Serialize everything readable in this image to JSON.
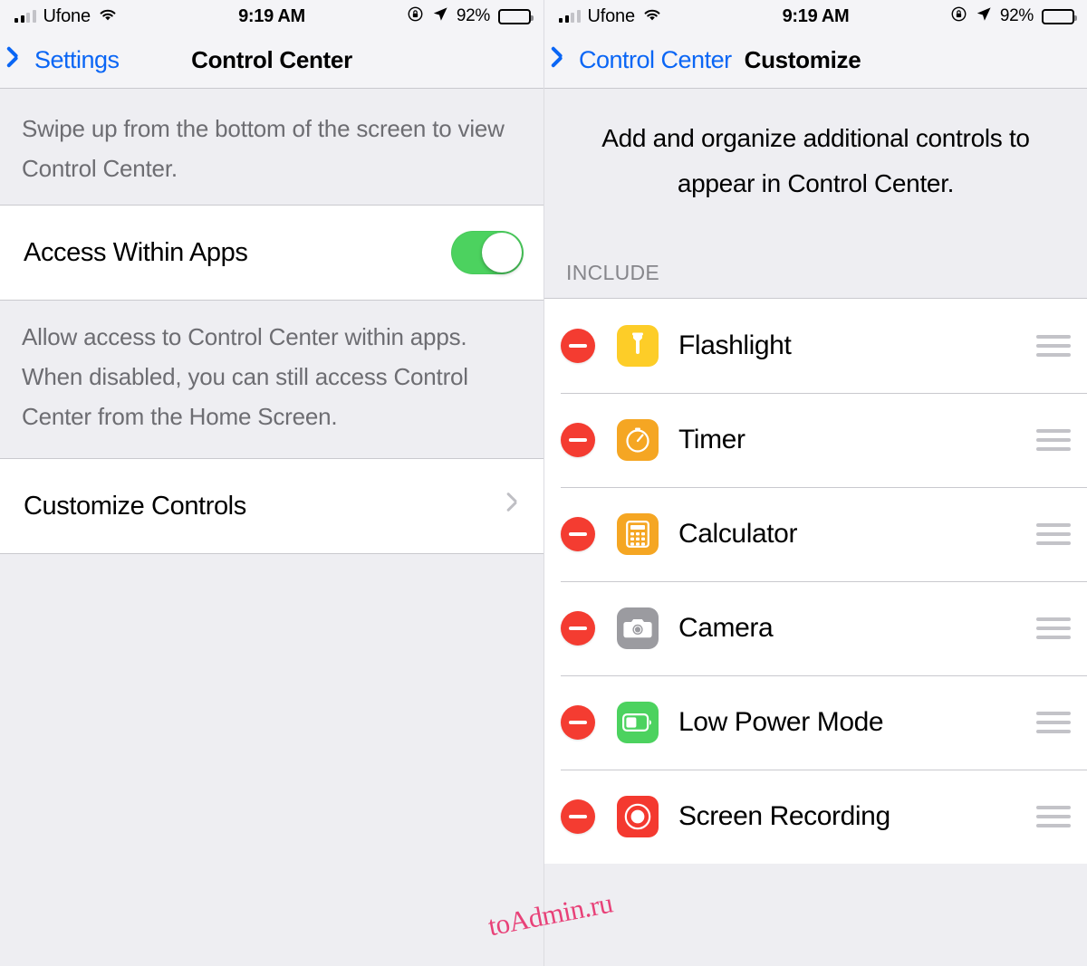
{
  "status_bar": {
    "carrier": "Ufone",
    "time": "9:19 AM",
    "battery_percent": "92%",
    "signal_bars_filled": 2,
    "signal_bars_total": 4,
    "icons": [
      "signal-bars-icon",
      "wifi-icon",
      "rotation-lock-icon",
      "location-arrow-icon",
      "battery-icon"
    ]
  },
  "left_screen": {
    "nav": {
      "back_label": "Settings",
      "title": "Control Center"
    },
    "header_footnote": "Swipe up from the bottom of the screen to view Control Center.",
    "access_row": {
      "label": "Access Within Apps",
      "toggle_state": "on",
      "toggle_color": "#4cd25f"
    },
    "access_footnote": "Allow access to Control Center within apps. When disabled, you can still access Control Center from the Home Screen.",
    "customize_row": {
      "label": "Customize Controls",
      "accessory": "chevron-right-icon"
    }
  },
  "right_screen": {
    "nav": {
      "back_label": "Control Center",
      "title": "Customize"
    },
    "intro": "Add and organize additional controls to appear in Control Center.",
    "section_header": "INCLUDE",
    "rows": [
      {
        "label": "Flashlight",
        "icon": "flashlight-icon",
        "icon_bg": "#fdcd28",
        "action": "remove",
        "handle": "reorder-handle-icon"
      },
      {
        "label": "Timer",
        "icon": "timer-icon",
        "icon_bg": "#f5a623",
        "action": "remove",
        "handle": "reorder-handle-icon"
      },
      {
        "label": "Calculator",
        "icon": "calculator-icon",
        "icon_bg": "#f5a623",
        "action": "remove",
        "handle": "reorder-handle-icon"
      },
      {
        "label": "Camera",
        "icon": "camera-icon",
        "icon_bg": "#9b9ba0",
        "action": "remove",
        "handle": "reorder-handle-icon"
      },
      {
        "label": "Low Power Mode",
        "icon": "battery-low-power-icon",
        "icon_bg": "#4cd25f",
        "action": "remove",
        "handle": "reorder-handle-icon"
      },
      {
        "label": "Screen Recording",
        "icon": "record-circle-icon",
        "icon_bg": "#f4392f",
        "action": "remove",
        "handle": "reorder-handle-icon"
      }
    ]
  },
  "watermark": {
    "text": "toAdmin.ru",
    "color": "#e8336e"
  },
  "colors": {
    "tint_blue": "#0a66f5",
    "green": "#4cd25f",
    "red": "#f43c31",
    "separator": "#c9c9ce",
    "group_bg": "#eeeef2"
  }
}
